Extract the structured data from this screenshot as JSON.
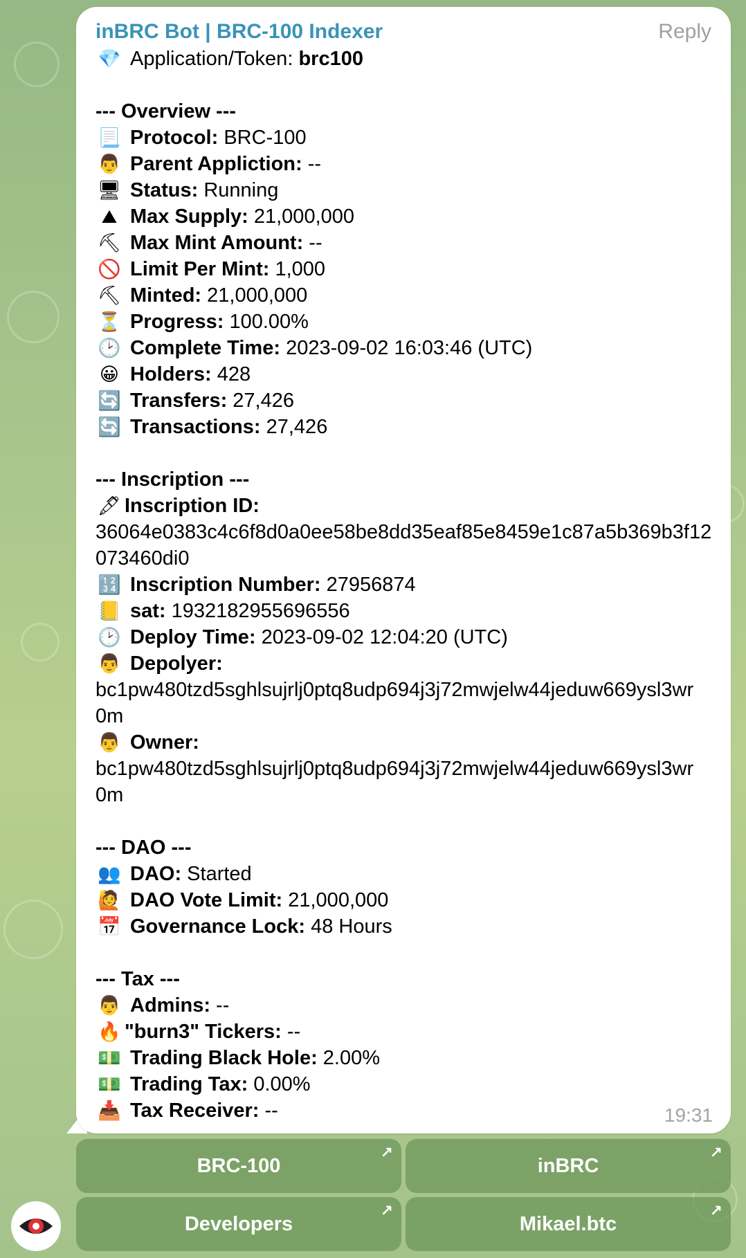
{
  "message": {
    "sender": "inBRC Bot | BRC-100 Indexer",
    "reply_label": "Reply",
    "time": "19:31",
    "app_token": {
      "icon": "💎",
      "label": "Application/Token:",
      "value": "brc100"
    },
    "overview_title": "--- Overview ---",
    "overview": [
      {
        "icon": "📃",
        "label": "Protocol:",
        "value": " BRC-100"
      },
      {
        "icon": "👨",
        "label": "Parent Appliction:",
        "value": " --"
      },
      {
        "icon": "🖥",
        "label": "Status:",
        "value": " Running"
      },
      {
        "icon": "⛰",
        "label": "Max Supply:",
        "value": " 21,000,000"
      },
      {
        "icon": "⛏",
        "label": "Max Mint Amount:",
        "value": " --"
      },
      {
        "icon": "🚫",
        "label": "Limit Per Mint:",
        "value": " 1,000"
      },
      {
        "icon": "⛏",
        "label": "Minted:",
        "value": " 21,000,000"
      },
      {
        "icon": "⏳",
        "label": "Progress:",
        "value": " 100.00%"
      },
      {
        "icon": "🕑",
        "label": "Complete Time:",
        "value": " 2023-09-02 16:03:46 (UTC)"
      },
      {
        "icon": "😀",
        "label": "Holders:",
        "value": " 428"
      },
      {
        "icon": "🔄",
        "label": "Transfers:",
        "value": " 27,426"
      },
      {
        "icon": "🔄",
        "label": "Transactions:",
        "value": " 27,426"
      }
    ],
    "inscription_title": "--- Inscription ---",
    "inscription": {
      "id": {
        "icon": "🖋",
        "label": "Inscription ID:",
        "lines": [
          "36064e0383c4c6f8d0a0ee58be8dd35eaf85e8459e1c87a5b369b3f12",
          "073460di0"
        ]
      },
      "number": {
        "icon": "🔢",
        "label": "Inscription Number:",
        "value": " 27956874"
      },
      "sat": {
        "icon": "📒",
        "label": "sat:",
        "value": " 1932182955696556"
      },
      "deploy_time": {
        "icon": "🕑",
        "label": "Deploy Time:",
        "value": " 2023-09-02 12:04:20 (UTC)"
      },
      "deployer": {
        "icon": "👨",
        "label": "Depolyer:",
        "lines": [
          "bc1pw480tzd5sghlsujrlj0ptq8udp694j3j72mwjelw44jeduw669ysl3wr",
          "0m"
        ]
      },
      "owner": {
        "icon": "👨",
        "label": "Owner:",
        "lines": [
          "bc1pw480tzd5sghlsujrlj0ptq8udp694j3j72mwjelw44jeduw669ysl3wr",
          "0m"
        ]
      }
    },
    "dao_title": "--- DAO ---",
    "dao": [
      {
        "icon": "👥",
        "label": "DAO:",
        "value": " Started"
      },
      {
        "icon": "🙋",
        "label": "DAO Vote Limit:",
        "value": " 21,000,000"
      },
      {
        "icon": "📅",
        "label": "Governance Lock:",
        "value": " 48 Hours"
      }
    ],
    "tax_title": "--- Tax ---",
    "tax": [
      {
        "icon": "👨",
        "label": "Admins:",
        "value": " --"
      },
      {
        "icon": "🔥",
        "label": "\"burn3\" Tickers:",
        "value": " --"
      },
      {
        "icon": "💵",
        "label": "Trading Black Hole:",
        "value": " 2.00%"
      },
      {
        "icon": "💵",
        "label": "Trading Tax:",
        "value": " 0.00%"
      },
      {
        "icon": "📥",
        "label": "Tax Receiver:",
        "value": " --"
      }
    ]
  },
  "buttons": [
    {
      "label": "BRC-100",
      "arrow": "↗"
    },
    {
      "label": "inBRC",
      "arrow": "↗"
    },
    {
      "label": "Developers",
      "arrow": "↗"
    },
    {
      "label": "Mikael.btc",
      "arrow": "↗"
    }
  ]
}
